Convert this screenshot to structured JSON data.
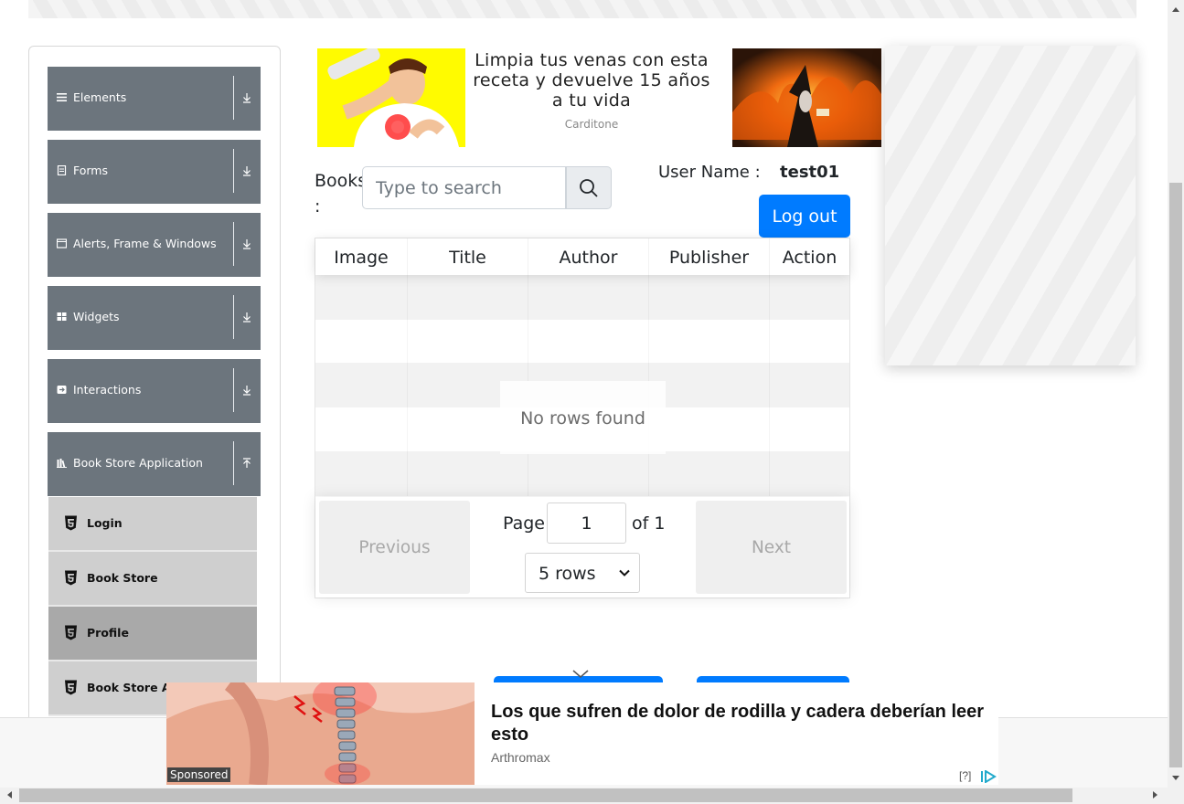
{
  "side_menu": {
    "groups": [
      {
        "label": "Elements",
        "icon": "hamburger-icon"
      },
      {
        "label": "Forms",
        "icon": "document-icon"
      },
      {
        "label": "Alerts, Frame & Windows",
        "icon": "window-icon"
      },
      {
        "label": "Widgets",
        "icon": "grid-icon"
      },
      {
        "label": "Interactions",
        "icon": "interaction-icon"
      },
      {
        "label": "Book Store Application",
        "icon": "books-icon"
      }
    ],
    "items": [
      {
        "label": "Login",
        "icon": "html5-icon",
        "active": false
      },
      {
        "label": "Book Store",
        "icon": "html5-icon",
        "active": false
      },
      {
        "label": "Profile",
        "icon": "html5-icon",
        "active": true
      },
      {
        "label": "Book Store API",
        "icon": "html5-icon",
        "active": false
      }
    ]
  },
  "top_ad": {
    "headline": "Limpia tus venas con esta receta y devuelve 15 años a tu vida",
    "source": "Carditone"
  },
  "books": {
    "label": "Books :",
    "search_placeholder": "Type to search",
    "search_value": ""
  },
  "user": {
    "label": "User Name :",
    "value": "test01",
    "logout_label": "Log out"
  },
  "table": {
    "columns": [
      "Image",
      "Title",
      "Author",
      "Publisher",
      "Action"
    ],
    "empty_text": "No rows found",
    "previous_label": "Previous",
    "next_label": "Next",
    "page_label": "Page",
    "page_value": "1",
    "of_label": "of 1",
    "rows_option": "5 rows"
  },
  "bottom_ad": {
    "sponsored": "Sponsored",
    "headline": "Los que sufren de dolor de rodilla y cadera deberían leer esto",
    "source": "Arthromax",
    "adchoice": "[?]"
  },
  "colors": {
    "menu_header": "#6c757d",
    "menu_item": "#cfcfcf",
    "menu_item_active": "#a9a9a9",
    "primary": "#007bff"
  }
}
